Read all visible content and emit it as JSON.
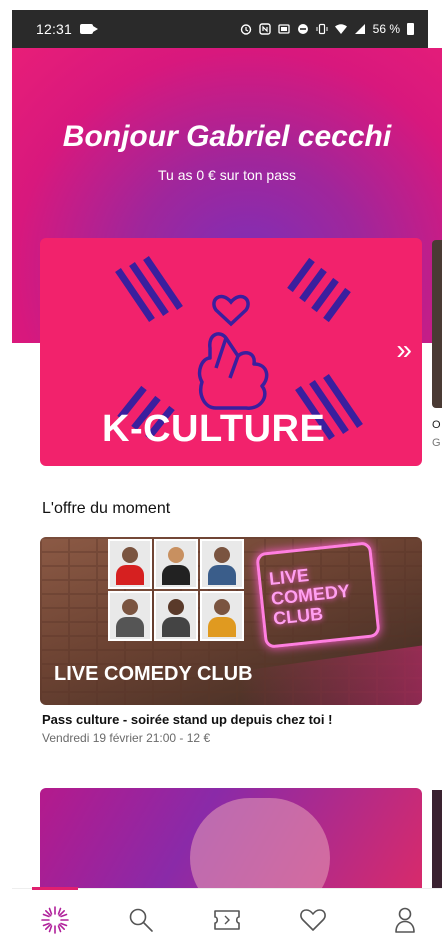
{
  "status_bar": {
    "time": "12:31",
    "battery": "56 %"
  },
  "hero": {
    "greeting": "Bonjour Gabriel cecchi",
    "balance_text": "Tu as 0 € sur ton pass"
  },
  "featured_card": {
    "title": "K-CULTURE",
    "next_chevron": "»"
  },
  "peek_card": {
    "letters": [
      "O",
      "G"
    ]
  },
  "section": {
    "title": "L'offre du moment"
  },
  "offer_card": {
    "label": "LIVE COMEDY CLUB",
    "neon_text": "LIVE COMEDY CLUB",
    "title": "Pass culture - soirée stand up depuis chez toi !",
    "meta": "Vendredi 19 février 21:00 - 12 €"
  },
  "tabs": [
    {
      "name": "home-icon",
      "active": true
    },
    {
      "name": "search-icon",
      "active": false
    },
    {
      "name": "ticket-icon",
      "active": false
    },
    {
      "name": "heart-icon",
      "active": false
    },
    {
      "name": "profile-icon",
      "active": false
    }
  ],
  "colors": {
    "accent": "#e0206f",
    "card_pink": "#f2226c",
    "stripe_blue": "#3a1f9e"
  }
}
